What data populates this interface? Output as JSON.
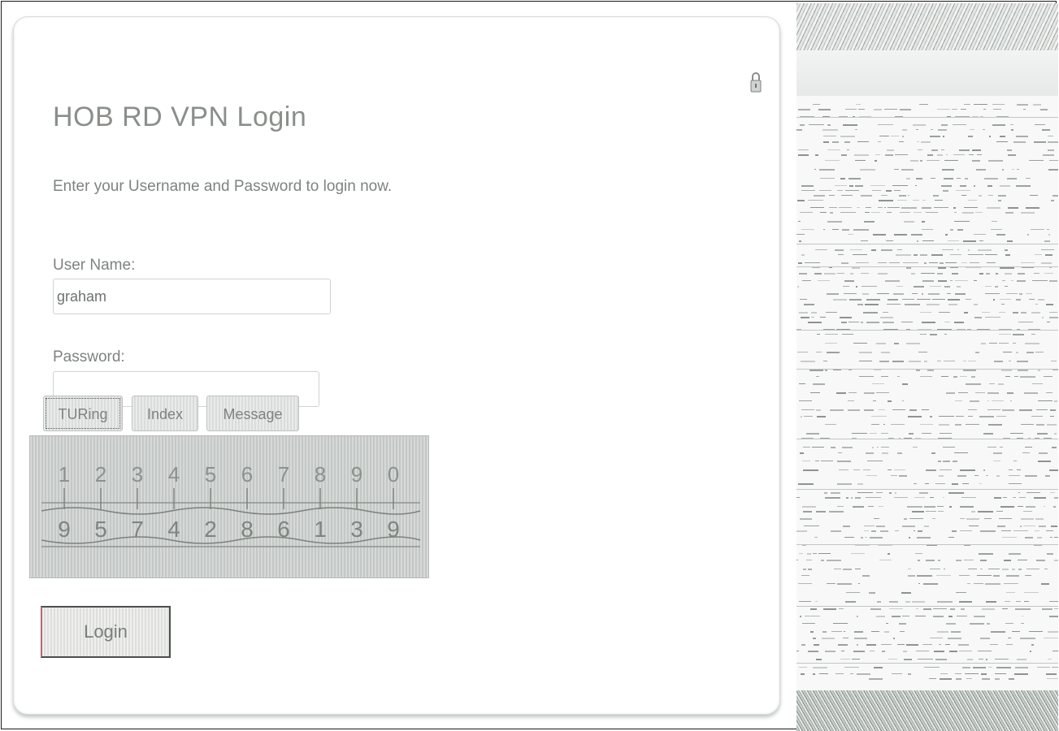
{
  "login_card": {
    "title": "HOB RD VPN Login",
    "subtitle": "Enter your Username and Password to login now.",
    "username_label": "User Name:",
    "username_value": "graham",
    "password_label": "Password:",
    "password_value": "",
    "tabs": [
      {
        "label": "TURing",
        "selected": true
      },
      {
        "label": "Index",
        "selected": false
      },
      {
        "label": "Message",
        "selected": false
      }
    ],
    "turing_ring": {
      "top_digits": [
        "1",
        "2",
        "3",
        "4",
        "5",
        "6",
        "7",
        "8",
        "9",
        "0"
      ],
      "bottom_digits": [
        "9",
        "5",
        "7",
        "4",
        "2",
        "8",
        "6",
        "1",
        "3",
        "9"
      ]
    },
    "login_button_label": "Login",
    "icons": {
      "lock": "lock-icon"
    }
  },
  "colors": {
    "text": "#8a8f8b",
    "card_border": "#d9dcda",
    "button_border": "#4a4f4c"
  }
}
